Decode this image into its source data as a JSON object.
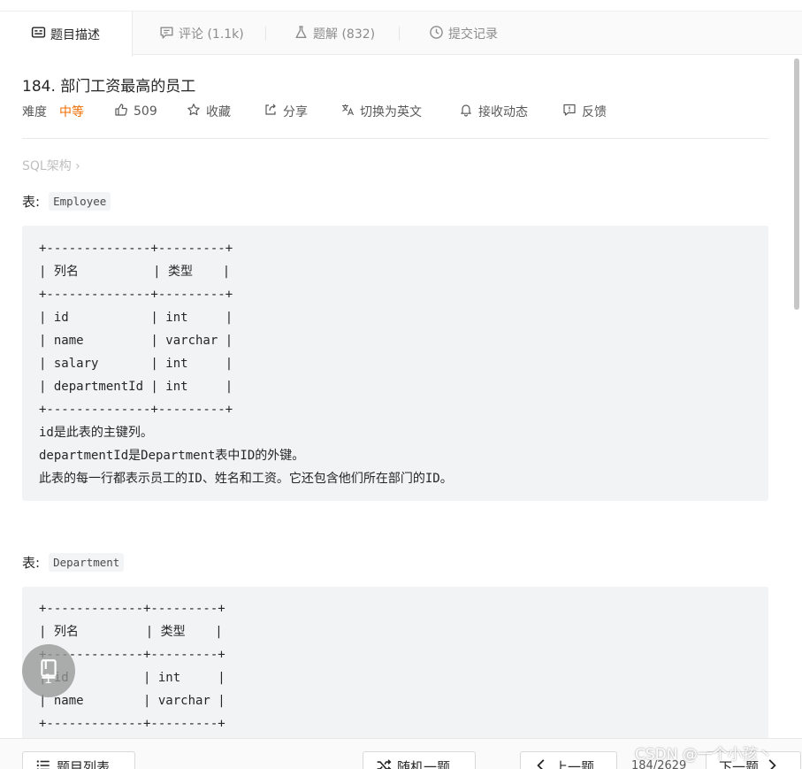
{
  "tabs": [
    {
      "label": "题目描述",
      "icon": "description-icon",
      "active": true
    },
    {
      "label": "评论 (1.1k)",
      "icon": "comment-icon",
      "active": false
    },
    {
      "label": "题解 (832)",
      "icon": "flask-icon",
      "active": false
    },
    {
      "label": "提交记录",
      "icon": "clock-icon",
      "active": false
    }
  ],
  "problem": {
    "title": "184. 部门工资最高的员工",
    "difficulty_label": "难度",
    "difficulty": "中等",
    "likes": "509",
    "favorite": "收藏",
    "share": "分享",
    "translate": "切换为英文",
    "subscribe": "接收动态",
    "feedback": "反馈",
    "breadcrumb": "SQL架构 ›"
  },
  "tables": [
    {
      "label": "表:",
      "name": "Employee",
      "lines": [
        "+--------------+---------+",
        "| 列名          | 类型    |",
        "+--------------+---------+",
        "| id           | int     |",
        "| name         | varchar |",
        "| salary       | int     |",
        "| departmentId | int     |",
        "+--------------+---------+",
        "id是此表的主键列。",
        "departmentId是Department表中ID的外键。",
        "此表的每一行都表示员工的ID、姓名和工资。它还包含他们所在部门的ID。"
      ]
    },
    {
      "label": "表:",
      "name": "Department",
      "lines": [
        "+-------------+---------+",
        "| 列名         | 类型    |",
        "+-------------+---------+",
        "| id          | int     |",
        "| name        | varchar |",
        "+-------------+---------+"
      ]
    }
  ],
  "floating": {
    "icon": "notebook-icon",
    "count": "1"
  },
  "bottom": {
    "list": "题目列表",
    "random": "随机一题",
    "prev": "上一题",
    "page": "184/2629",
    "next": "下一题"
  },
  "watermark": "CSDN @一个小孩丶",
  "colors": {
    "accent_difficulty": "#ef6c00",
    "code_bg": "#f2f3f5"
  }
}
